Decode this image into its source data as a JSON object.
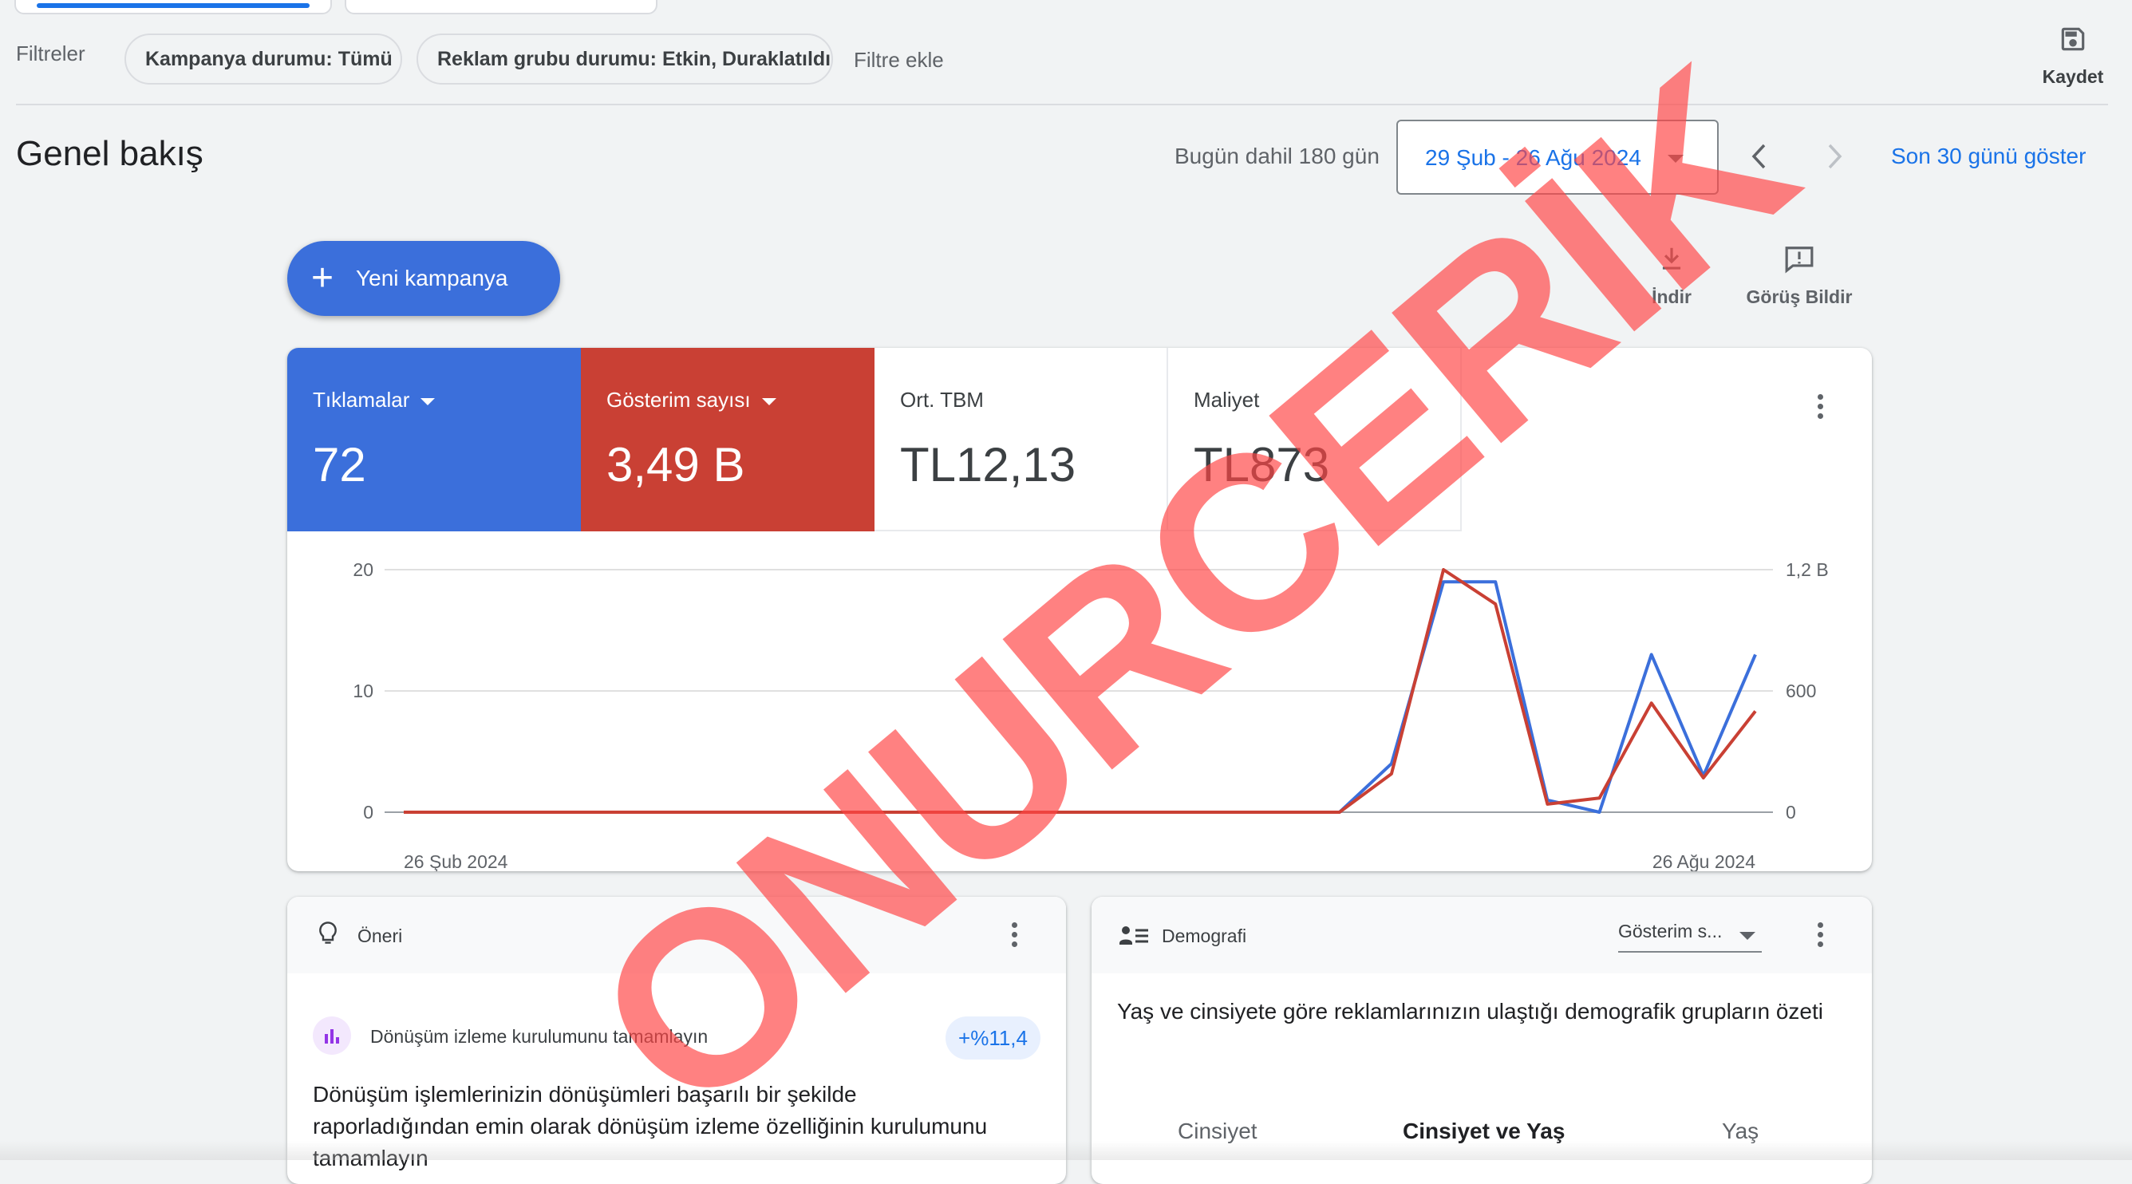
{
  "filters": {
    "label": "Filtreler",
    "chips": [
      "Kampanya durumu: Tümü",
      "Reklam grubu durumu: Etkin, Duraklatıldı"
    ],
    "add_filter": "Filtre ekle",
    "save_label": "Kaydet"
  },
  "header": {
    "title": "Genel bakış",
    "range_label": "Bugün dahil 180 gün",
    "date_range": "29 Şub - 26 Ağu 2024",
    "last30": "Son 30 günü göster"
  },
  "actions": {
    "new_campaign": "Yeni kampanya",
    "download": "İndir",
    "feedback": "Görüş Bildir"
  },
  "metrics": [
    {
      "label": "Tıklamalar",
      "value": "72"
    },
    {
      "label": "Gösterim sayısı",
      "value": "3,49 B"
    },
    {
      "label": "Ort. TBM",
      "value": "TL12,13"
    },
    {
      "label": "Maliyet",
      "value": "TL873"
    }
  ],
  "chart_data": {
    "type": "line",
    "x_start_label": "26 Şub 2024",
    "x_end_label": "26 Ağu 2024",
    "left_axis_ticks": [
      "20",
      "10",
      "0"
    ],
    "right_axis_ticks": [
      "1,2 B",
      "600",
      "0"
    ],
    "left_ylim": [
      0,
      20
    ],
    "right_ylim": [
      0,
      1200
    ],
    "x": [
      0,
      1,
      2,
      3,
      4,
      5,
      6,
      7,
      8,
      9,
      10,
      11,
      12,
      13,
      14,
      15,
      16,
      17,
      18,
      19,
      20,
      21,
      22,
      23,
      24,
      25,
      26
    ],
    "series": [
      {
        "color": "#3b6fdb",
        "axis": "left",
        "values": [
          0,
          0,
          0,
          0,
          0,
          0,
          0,
          0,
          0,
          0,
          0,
          0,
          0,
          0,
          0,
          0,
          0,
          0,
          0,
          4,
          19,
          19,
          1,
          0,
          13,
          3,
          13
        ]
      },
      {
        "color": "#c94034",
        "axis": "right",
        "values": [
          0,
          0,
          0,
          0,
          0,
          0,
          0,
          0,
          0,
          0,
          0,
          0,
          0,
          0,
          0,
          0,
          0,
          0,
          0,
          190,
          1200,
          1030,
          40,
          70,
          540,
          170,
          500
        ]
      }
    ]
  },
  "recommendation": {
    "title": "Öneri",
    "item": "Dönüşüm izleme kurulumunu tamamlayın",
    "badge": "+%11,4",
    "body": "Dönüşüm işlemlerinizin dönüşümleri başarılı bir şekilde raporladığından emin olarak dönüşüm izleme özelliğinin kurulumunu tamamlayın"
  },
  "demographics": {
    "title": "Demografi",
    "select": "Gösterim s...",
    "description": "Yaş ve cinsiyete göre reklamlarınızın ulaştığı demografik grupların özeti",
    "tabs": [
      "Cinsiyet",
      "Cinsiyet ve Yaş",
      "Yaş"
    ]
  },
  "watermark": "ONURCERİK",
  "colors": {
    "accent": "#1a73e8",
    "clicks": "#3b6fdb",
    "impressions": "#c94034"
  }
}
